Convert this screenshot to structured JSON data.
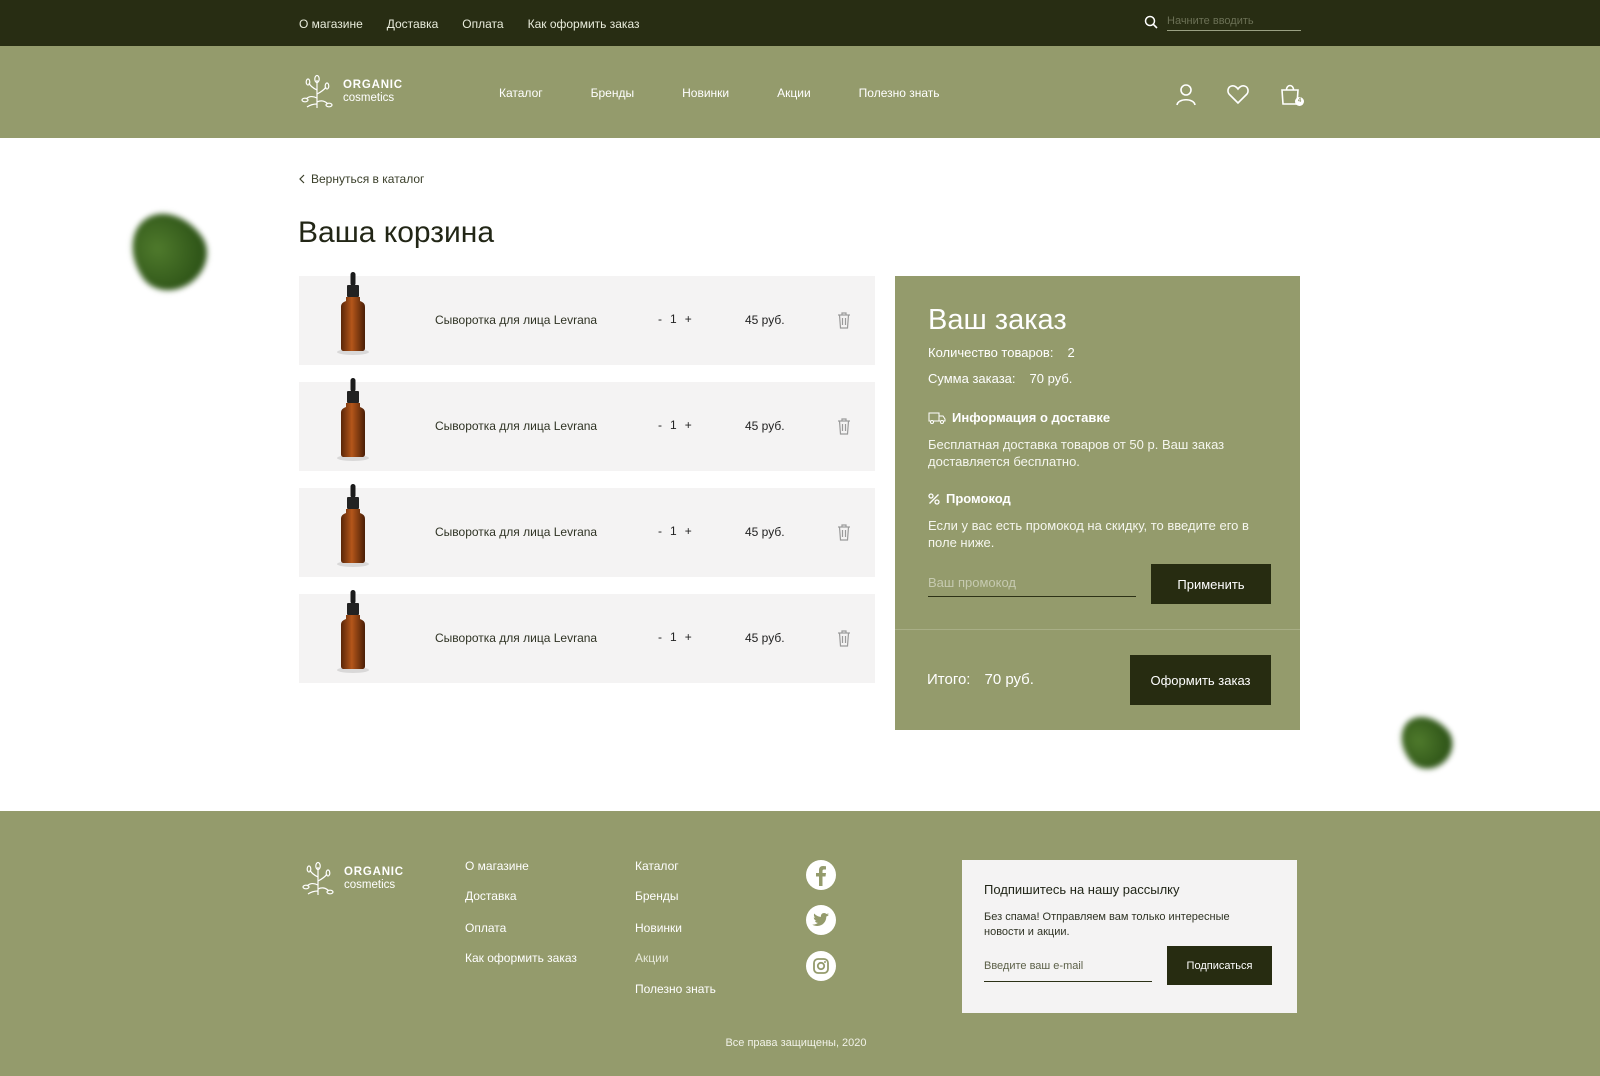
{
  "topbar": {
    "links": [
      "О магазине",
      "Доставка",
      "Оплата",
      "Как оформить заказ"
    ],
    "search_placeholder": "Начните вводить"
  },
  "brand": {
    "line1": "ORGANIC",
    "line2": "cosmetics"
  },
  "header": {
    "nav": [
      "Каталог",
      "Бренды",
      "Новинки",
      "Акции",
      "Полезно знать"
    ],
    "cart_count": "4"
  },
  "page": {
    "back_link": "Вернуться в каталог",
    "title": "Ваша корзина"
  },
  "cart": {
    "items": [
      {
        "name": "Сыворотка для лица Levrana",
        "qty": "1",
        "price": "45 руб."
      },
      {
        "name": "Сыворотка для лица Levrana",
        "qty": "1",
        "price": "45 руб."
      },
      {
        "name": "Сыворотка для лица Levrana",
        "qty": "1",
        "price": "45 руб."
      },
      {
        "name": "Сыворотка для лица Levrana",
        "qty": "1",
        "price": "45 руб."
      }
    ],
    "minus": "-",
    "plus": "+"
  },
  "order": {
    "title": "Ваш заказ",
    "count_label": "Количество  товаров:",
    "count_value": "2",
    "sum_label": "Сумма заказа:",
    "sum_value": "70 руб.",
    "delivery_title": "Информация о доставке",
    "delivery_text": "Бесплатная доставка товаров от 50 р. Ваш заказ доставляется бесплатно.",
    "promo_title": "Промокод",
    "promo_text": "Если у вас есть промокод на скидку, то введите его в поле ниже.",
    "promo_placeholder": "Ваш промокод",
    "apply_label": "Применить",
    "total_label": "Итого:",
    "total_value": "70 руб.",
    "checkout_label": "Оформить заказ"
  },
  "footer": {
    "col1": [
      "О магазине",
      "Доставка",
      "Оплата",
      "Как оформить заказ"
    ],
    "col2": [
      "Каталог",
      "Бренды",
      "Новинки",
      "Акции",
      "Полезно знать"
    ],
    "social": [
      "facebook-icon",
      "twitter-icon",
      "instagram-icon"
    ],
    "subscribe_title": "Подпишитесь на нашу рассылку",
    "subscribe_text": "Без спама! Отправляем вам только интересные новости и акции.",
    "email_placeholder": "Введите ваш e-mail",
    "subscribe_button": "Подписаться",
    "copyright": "Все права защищены, 2020"
  },
  "colors": {
    "dark": "#282d13",
    "olive": "#949b6c",
    "button": "#272c11",
    "item_bg": "#f4f3f3"
  }
}
